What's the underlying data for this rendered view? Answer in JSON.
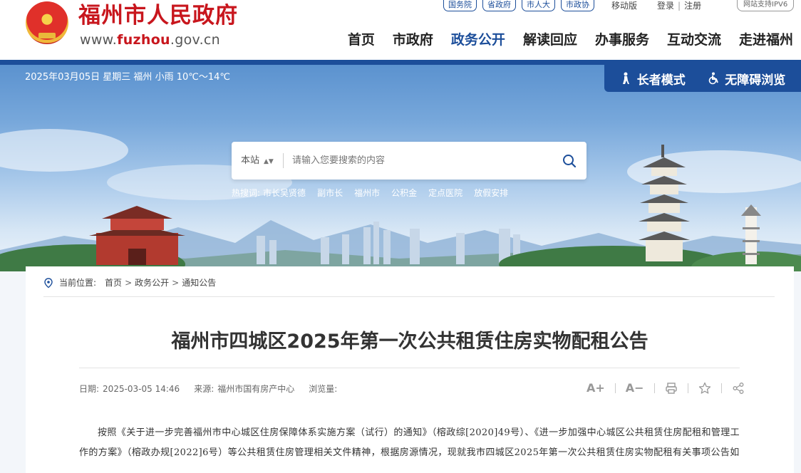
{
  "header": {
    "site_name": "福州市人民政府",
    "url_prefix": "www.",
    "url_highlight": "fuzhou",
    "url_suffix": ".gov.cn",
    "top_chips": [
      "国务院",
      "省政府",
      "市人大",
      "市政协"
    ],
    "top_links": {
      "mobile": "移动版",
      "login": "登录",
      "separator": "|",
      "register": "注册"
    },
    "ipv6": "网站支持IPV6",
    "nav": [
      {
        "label": "首页",
        "active": false
      },
      {
        "label": "市政府",
        "active": false
      },
      {
        "label": "政务公开",
        "active": true
      },
      {
        "label": "解读回应",
        "active": false
      },
      {
        "label": "办事服务",
        "active": false
      },
      {
        "label": "互动交流",
        "active": false
      },
      {
        "label": "走进福州",
        "active": false
      }
    ]
  },
  "banner": {
    "date_weather": "2025年03月05日 星期三  福州 小雨 10℃～14℃",
    "elder_mode": "长者模式",
    "accessible": "无障碍浏览",
    "search": {
      "scope": "本站",
      "placeholder": "请输入您要搜索的内容"
    },
    "hot_label": "热搜词:",
    "hot_words": [
      "市长吴贤德",
      "副市长",
      "福州市",
      "公积金",
      "定点医院",
      "放假安排"
    ]
  },
  "breadcrumb": {
    "label": "当前位置:",
    "items": [
      "首页",
      "政务公开",
      "通知公告"
    ],
    "sep": ">"
  },
  "article": {
    "title": "福州市四城区2025年第一次公共租赁住房实物配租公告",
    "date_label": "日期:",
    "date": "2025-03-05 14:46",
    "source_label": "来源:",
    "source": "福州市国有房产中心",
    "views_label": "浏览量:",
    "tools": {
      "font_up": "A+",
      "font_down": "A−",
      "sep": "|"
    },
    "paragraph": "按照《关于进一步完善福州市中心城区住房保障体系实施方案（试行）的通知》（榕政综[2020]49号）、《进一步加强中心城区公共租赁住房配租和管理工作的方案》（榕政办规[2022]6号）等公共租赁住房管理相关文件精神，根据房源情况，现就我市四城区2025年第一次公共租赁住房实物配租有关事项公告如"
  },
  "colors": {
    "brand_red": "#c8161d",
    "brand_blue": "#1c4e9a"
  },
  "icons": [
    "emblem-icon",
    "elder-icon",
    "wheelchair-icon",
    "search-icon",
    "location-pin-icon",
    "print-icon",
    "star-icon",
    "share-icon"
  ]
}
